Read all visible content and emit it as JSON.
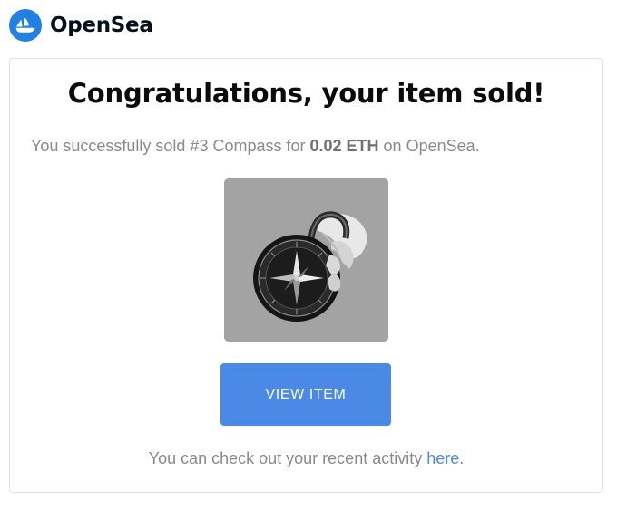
{
  "brand": {
    "name": "OpenSea",
    "logo_icon": "opensea-sailboat-logo-icon",
    "logo_color": "#2081e2"
  },
  "email": {
    "title": "Congratulations, your item sold!",
    "message": {
      "before": "You successfully sold #3 Compass for ",
      "price": "0.02 ETH",
      "after": " on OpenSea."
    },
    "item_image": {
      "icon": "compass-nft-image",
      "alt": "#3 Compass"
    },
    "button_label": "VIEW ITEM",
    "footer": {
      "before": "You can check out your recent activity ",
      "link_label": "here",
      "after": "."
    }
  },
  "colors": {
    "accent": "#4a8ae6",
    "muted_text": "#8a8a8a",
    "title_text": "#0b0b0b"
  }
}
